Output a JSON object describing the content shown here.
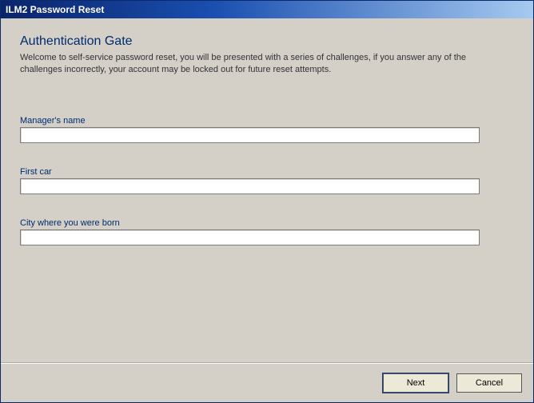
{
  "window": {
    "title": "ILM2 Password Reset"
  },
  "page": {
    "heading": "Authentication Gate",
    "intro": "Welcome to self-service password reset, you will be presented with a series of challenges, if you answer any of the challenges incorrectly, your account may be locked out for future reset attempts."
  },
  "fields": [
    {
      "label": "Manager's name",
      "value": ""
    },
    {
      "label": "First car",
      "value": ""
    },
    {
      "label": "City where you were born",
      "value": ""
    }
  ],
  "buttons": {
    "next": "Next",
    "cancel": "Cancel"
  }
}
